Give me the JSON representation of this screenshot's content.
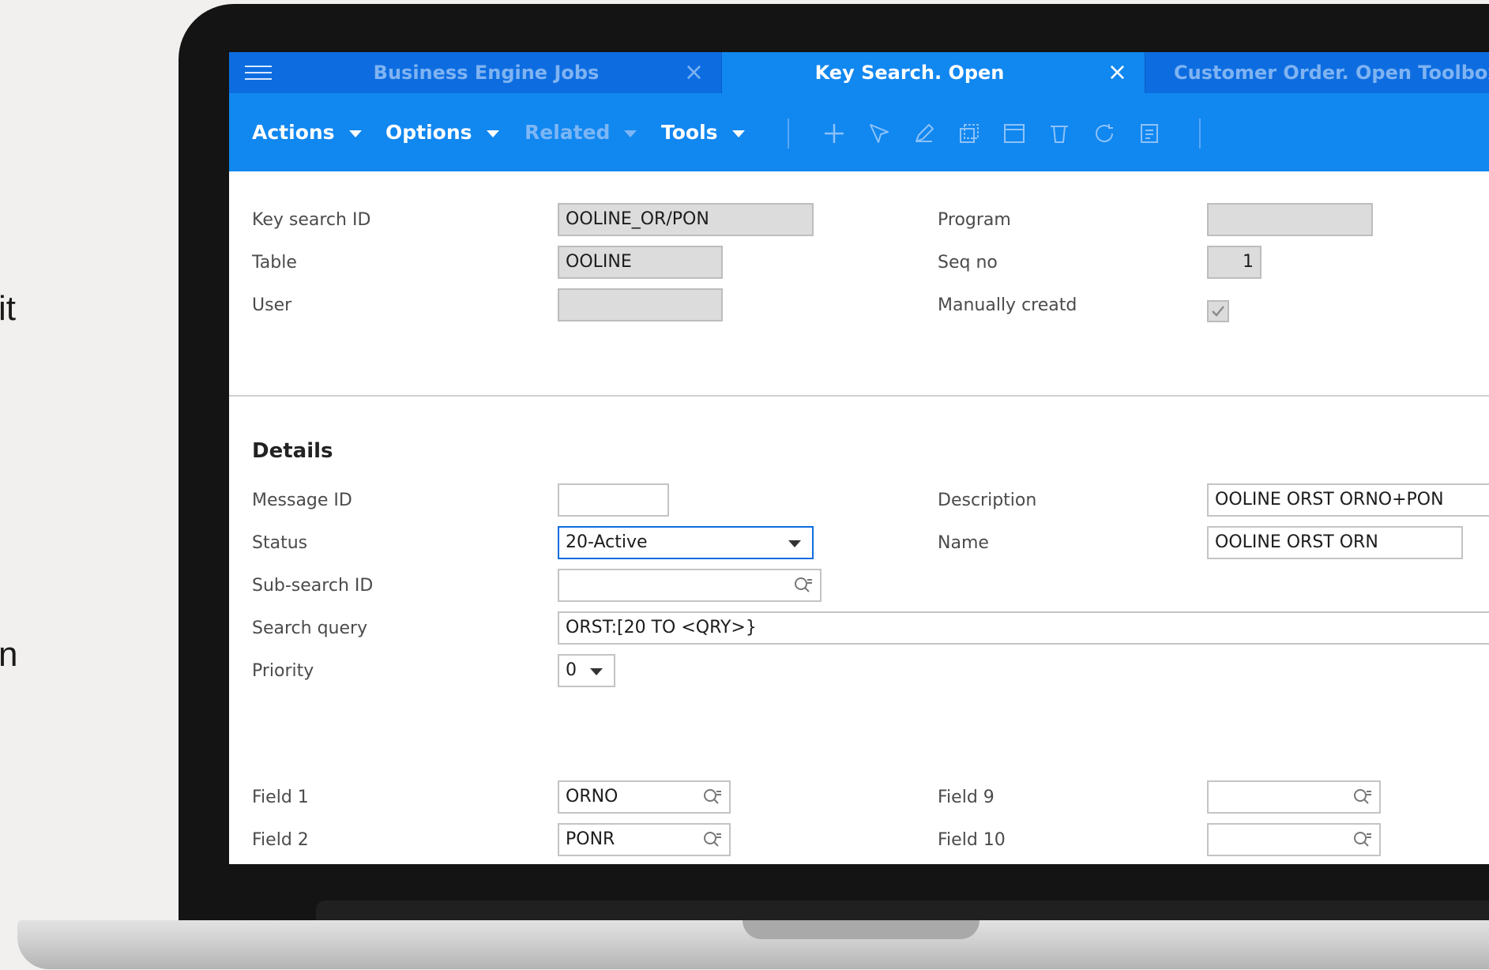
{
  "edge_text": {
    "top": "it",
    "bottom": "n"
  },
  "tabs": [
    {
      "label": "Business Engine Jobs",
      "close": "×"
    },
    {
      "label": "Key Search. Open",
      "close": "×"
    },
    {
      "label": "Customer Order. Open Toolbox"
    }
  ],
  "menus": {
    "actions": "Actions",
    "options": "Options",
    "related": "Related",
    "tools": "Tools"
  },
  "toolbar_icons": [
    "plus-icon",
    "select-arrow-icon",
    "edit-pencil-icon",
    "copy-icon",
    "window-icon",
    "delete-trash-icon",
    "refresh-icon",
    "notes-icon"
  ],
  "header": {
    "key_search_id": {
      "label": "Key search ID",
      "value": "OOLINE_OR/PON"
    },
    "table": {
      "label": "Table",
      "value": "OOLINE"
    },
    "user": {
      "label": "User",
      "value": ""
    },
    "program": {
      "label": "Program",
      "value": ""
    },
    "seq_no": {
      "label": "Seq no",
      "value": "1"
    },
    "manually_created": {
      "label": "Manually creatd",
      "checked": true
    }
  },
  "details": {
    "title": "Details",
    "message_id": {
      "label": "Message ID",
      "value": ""
    },
    "status": {
      "label": "Status",
      "value": "20-Active"
    },
    "sub_search_id": {
      "label": "Sub-search ID",
      "value": ""
    },
    "search_query": {
      "label": "Search query",
      "value": "ORST:[20 TO <QRY>}"
    },
    "priority": {
      "label": "Priority",
      "value": "0"
    },
    "description": {
      "label": "Description",
      "value": "OOLINE ORST ORNO+PON"
    },
    "name": {
      "label": "Name",
      "value": "OOLINE ORST ORN"
    }
  },
  "fields": {
    "field1": {
      "label": "Field 1",
      "value": "ORNO"
    },
    "field2": {
      "label": "Field 2",
      "value": "PONR"
    },
    "field9": {
      "label": "Field 9",
      "value": ""
    },
    "field10": {
      "label": "Field 10",
      "value": ""
    }
  },
  "colors": {
    "tabbar": "#0d6de0",
    "toolbar": "#1187f0",
    "active_tab": "#1187f0"
  }
}
